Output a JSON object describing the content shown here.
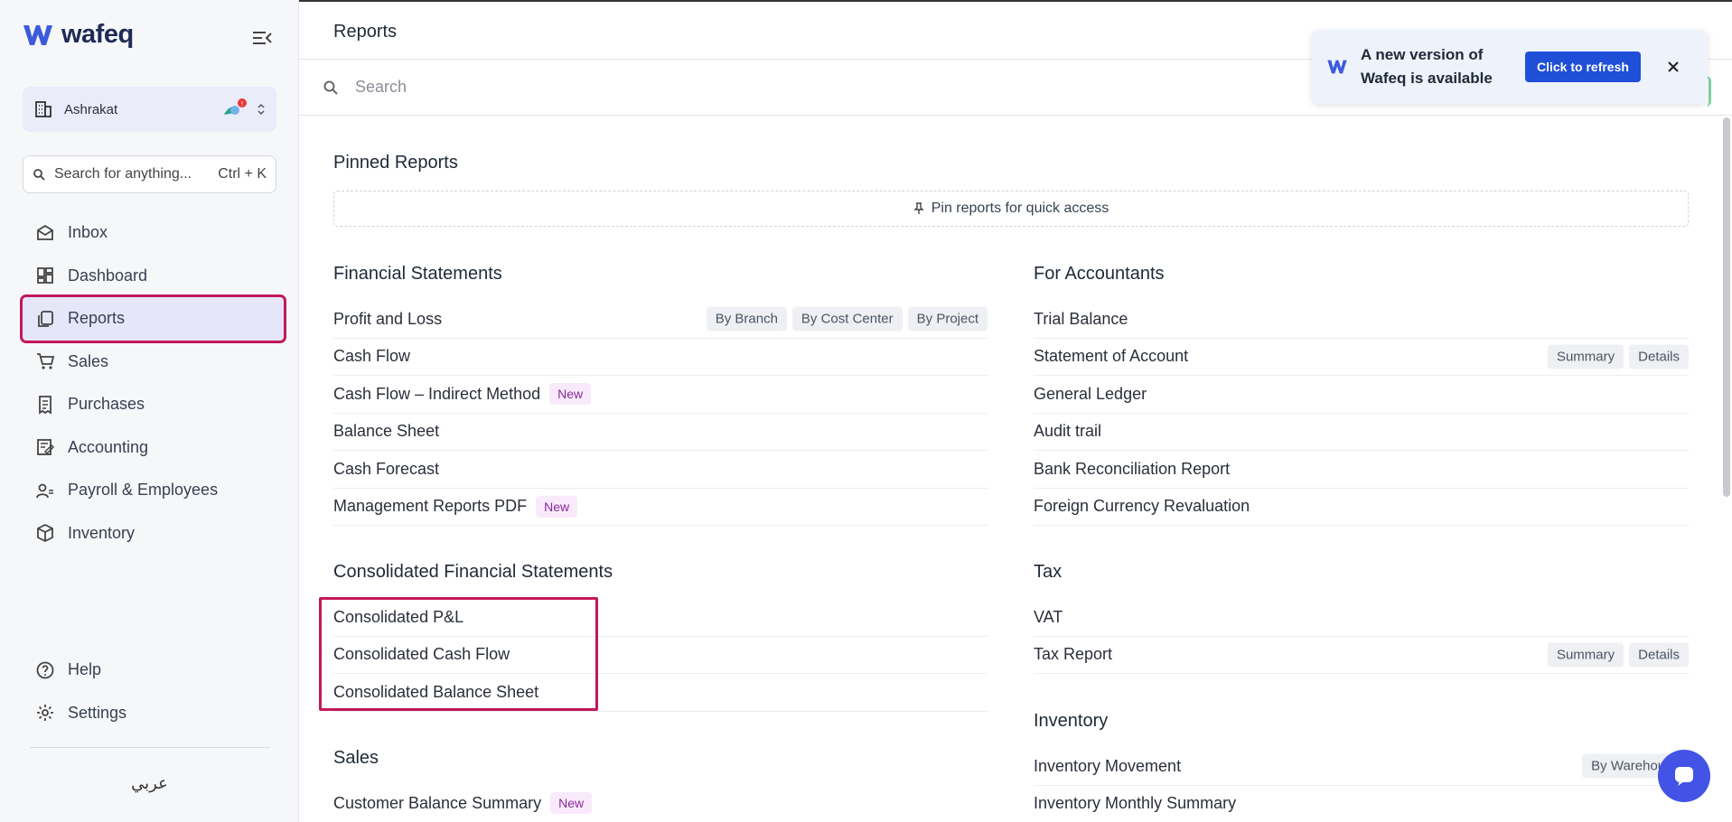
{
  "app": {
    "logo_text": "wafeq"
  },
  "sidebar": {
    "org_name": "Ashrakat",
    "search_placeholder": "Search for anything...",
    "search_shortcut": "Ctrl + K",
    "items": [
      {
        "label": "Inbox",
        "icon": "inbox-icon"
      },
      {
        "label": "Dashboard",
        "icon": "dashboard-icon"
      },
      {
        "label": "Reports",
        "icon": "reports-icon",
        "active": true
      },
      {
        "label": "Sales",
        "icon": "cart-icon"
      },
      {
        "label": "Purchases",
        "icon": "receipt-icon"
      },
      {
        "label": "Accounting",
        "icon": "ledger-icon"
      },
      {
        "label": "Payroll & Employees",
        "icon": "people-icon"
      },
      {
        "label": "Inventory",
        "icon": "box-icon"
      }
    ],
    "bottom_items": [
      {
        "label": "Help",
        "icon": "help-icon"
      },
      {
        "label": "Settings",
        "icon": "gear-icon"
      }
    ],
    "language": "عربي"
  },
  "header": {
    "title": "Reports"
  },
  "main_search": {
    "placeholder": "Search"
  },
  "toast": {
    "message": "A new version of Wafeq is available",
    "button": "Click to refresh"
  },
  "pinned": {
    "title": "Pinned Reports",
    "empty_text": "Pin reports for quick access"
  },
  "sections": {
    "financial": {
      "title": "Financial Statements",
      "rows": [
        {
          "label": "Profit and Loss",
          "badge": "",
          "chips": [
            "By Branch",
            "By Cost Center",
            "By Project"
          ]
        },
        {
          "label": "Cash Flow",
          "badge": "",
          "chips": []
        },
        {
          "label": "Cash Flow – Indirect Method",
          "badge": "New",
          "chips": []
        },
        {
          "label": "Balance Sheet",
          "badge": "",
          "chips": []
        },
        {
          "label": "Cash Forecast",
          "badge": "",
          "chips": []
        },
        {
          "label": "Management Reports PDF",
          "badge": "New",
          "chips": []
        }
      ]
    },
    "consolidated": {
      "title": "Consolidated Financial Statements",
      "rows": [
        {
          "label": "Consolidated P&L",
          "badge": "",
          "chips": []
        },
        {
          "label": "Consolidated Cash Flow",
          "badge": "",
          "chips": []
        },
        {
          "label": "Consolidated Balance Sheet",
          "badge": "",
          "chips": []
        }
      ]
    },
    "sales": {
      "title": "Sales",
      "rows": [
        {
          "label": "Customer Balance Summary",
          "badge": "New",
          "chips": []
        }
      ]
    },
    "accountants": {
      "title": "For Accountants",
      "rows": [
        {
          "label": "Trial Balance",
          "badge": "",
          "chips": []
        },
        {
          "label": "Statement of Account",
          "badge": "",
          "chips": [
            "Summary",
            "Details"
          ]
        },
        {
          "label": "General Ledger",
          "badge": "",
          "chips": []
        },
        {
          "label": "Audit trail",
          "badge": "",
          "chips": []
        },
        {
          "label": "Bank Reconciliation Report",
          "badge": "",
          "chips": []
        },
        {
          "label": "Foreign Currency Revaluation",
          "badge": "",
          "chips": []
        }
      ]
    },
    "tax": {
      "title": "Tax",
      "rows": [
        {
          "label": "VAT",
          "badge": "",
          "chips": []
        },
        {
          "label": "Tax Report",
          "badge": "",
          "chips": [
            "Summary",
            "Details"
          ]
        }
      ]
    },
    "inventory": {
      "title": "Inventory",
      "rows": [
        {
          "label": "Inventory Movement",
          "badge": "",
          "chips": [
            "By Warehouse"
          ]
        },
        {
          "label": "Inventory Monthly Summary",
          "badge": "",
          "chips": []
        }
      ]
    }
  },
  "colors": {
    "accent": "#1f4fd8",
    "highlight": "#c2185b",
    "brand": "#1f2a55"
  }
}
